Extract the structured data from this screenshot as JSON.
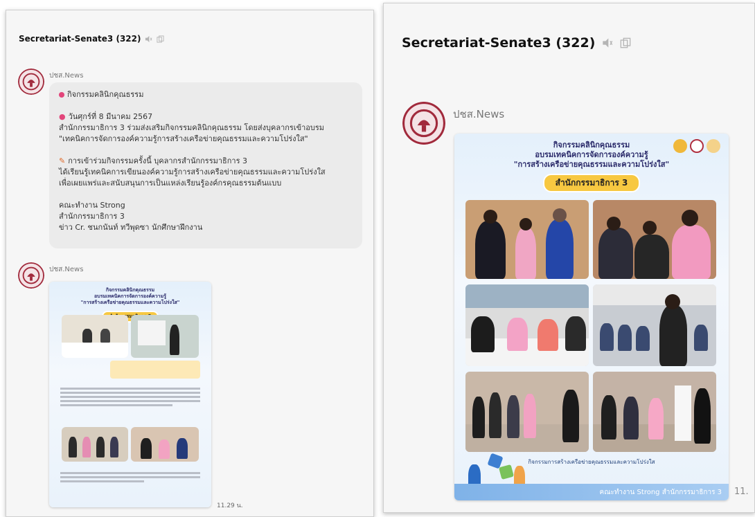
{
  "chat_title": "Secretariat-Senate3 (322)",
  "sender_name": "ปชส.News",
  "message": {
    "line1": "กิจกรรมคลินิกคุณธรรม",
    "line2": "วันศุกร์ที่ 8 มีนาคม 2567",
    "line3": "สำนักกรรมาธิการ 3 ร่วมส่งเสริมกิจกรรมคลินิกคุณธรรม โดยส่งบุคลากรเข้าอบรม",
    "line4": "\"เทคนิคการจัดการองค์ความรู้การสร้างเครือข่ายคุณธรรมและความโปร่งใส\"",
    "line5": "การเข้าร่วมกิจกรรมครั้งนี้ บุคลากรสำนักกรรมาธิการ 3",
    "line6": "ได้เรียนรู้เทคนิคการเขียนองค์ความรู้การสร้างเครือข่ายคุณธรรมและความโปร่งใส",
    "line7": "เพื่อเผยแพร่และสนับสนุนการเป็นแหล่งเรียนรู้องค์กรคุณธรรมต้นแบบ",
    "line8": "คณะทำงาน Strong",
    "line9": "สำนักกรรมาธิการ 3",
    "line10": "ข่าว Cr. ชนกนันท์ ทวีพุดซา นักศึกษาฝึกงาน"
  },
  "timestamp_left": "11.29 น.",
  "timestamp_right": "11.",
  "poster": {
    "title1": "กิจกรรมคลินิกคุณธรรม",
    "title2": "อบรมเทคนิคการจัดการองค์ความรู้",
    "title3": "\"การสร้างเครือข่ายคุณธรรมและความโปร่งใส\"",
    "office_badge": "สำนักกรรมาธิการ 3",
    "caption": "กิจกรรมการสร้างเครือข่ายคุณธรรมและความโปร่งใส",
    "footer": "คณะทำงาน Strong สำนักกรรมาธิการ 3"
  },
  "colors": {
    "accent_pink": "#e2457a",
    "badge_yellow": "#f7c841",
    "poster_title": "#2a2a6a",
    "footer_blue": "#7fb2e8"
  },
  "icons": [
    "mute-icon",
    "copy-icon"
  ]
}
